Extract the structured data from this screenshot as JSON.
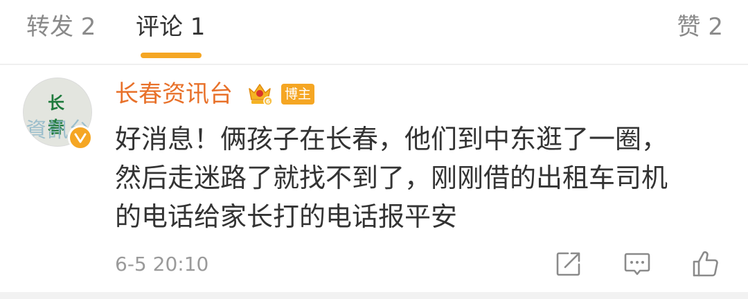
{
  "tabs": {
    "repost_label": "转发 2",
    "comment_label": "评论 1",
    "like_label": "赞 2",
    "active": "comment",
    "accent_color": "#f5a623"
  },
  "comment": {
    "avatar_icon": "avatar",
    "avatar_line1": "长 春",
    "avatar_line2": "資訊台",
    "verified_icon": "verified-v-badge-icon",
    "username": "长春资讯台",
    "username_color": "#e8712a",
    "member_icon": "crown-vip-level-6-icon",
    "badge_label": "博主",
    "text_lines": [
      "好消息！俩孩子在长春，他们到中东逛了一圈，",
      "然后走迷路了就找不到了，刚刚借的出租车司机",
      "的电话给家长打的电话报平安"
    ],
    "timestamp": "6-5 20:10"
  },
  "actions": {
    "share_icon": "share-icon",
    "reply_icon": "reply-comment-icon",
    "like_icon": "thumbs-up-icon"
  }
}
